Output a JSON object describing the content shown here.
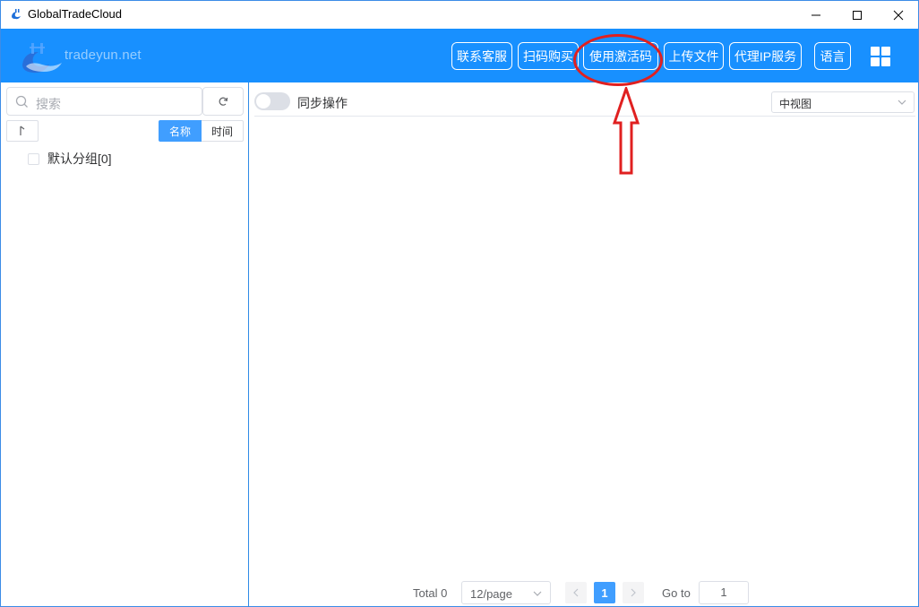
{
  "window": {
    "title": "GlobalTradeCloud"
  },
  "header": {
    "logo_text": "tradeyun.net",
    "buttons": {
      "contact": "联系客服",
      "scan_buy": "扫码购买",
      "activation_code": "使用激活码",
      "upload": "上传文件",
      "proxy_ip": "代理IP服务",
      "language": "语言"
    }
  },
  "sidebar": {
    "search_placeholder": "搜索",
    "sort_name": "名称",
    "sort_time": "时间",
    "groups": [
      {
        "label": "默认分组[0]"
      }
    ]
  },
  "main": {
    "sync_label": "同步操作",
    "view_mode": "中视图"
  },
  "pagination": {
    "total": "Total 0",
    "page_size": "12/page",
    "current_page": "1",
    "goto_label": "Go to",
    "goto_value": "1"
  },
  "colors": {
    "header_bg": "#1890ff",
    "primary": "#409eff",
    "annotation": "#e02020"
  },
  "icons": {
    "app": "app-logo-icon",
    "minimize": "minimize-icon",
    "maximize": "maximize-icon",
    "close": "close-icon",
    "search": "search-icon",
    "refresh": "refresh-icon",
    "sort": "sort-arrow-icon",
    "apps": "apps-grid-icon",
    "chevron": "chevron-down-icon"
  }
}
